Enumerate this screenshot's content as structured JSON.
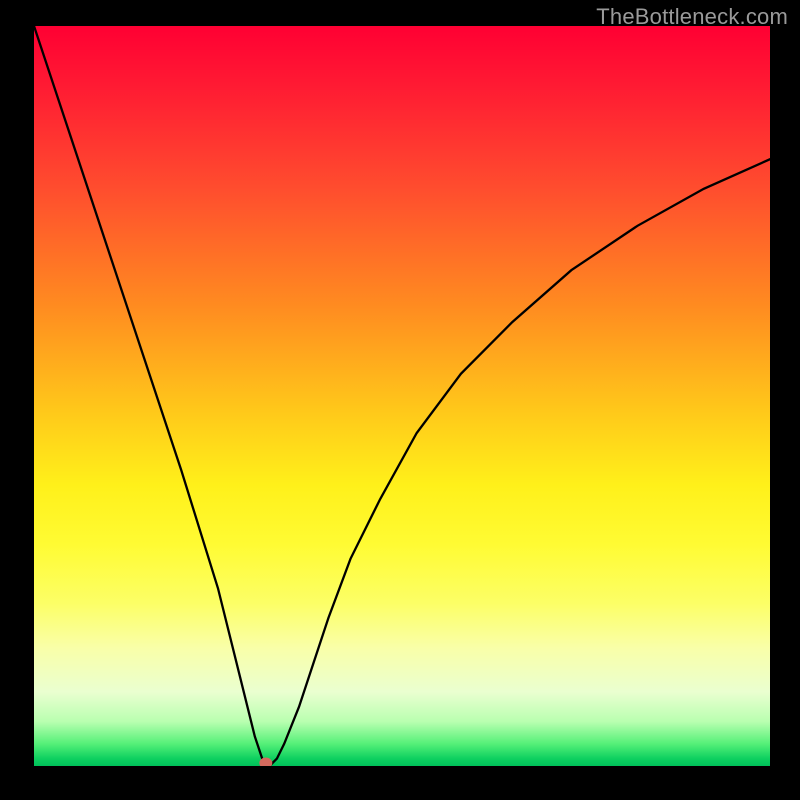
{
  "watermark": "TheBottleneck.com",
  "chart_data": {
    "type": "line",
    "title": "",
    "xlabel": "",
    "ylabel": "",
    "xlim": [
      0,
      100
    ],
    "ylim": [
      0,
      100
    ],
    "grid": false,
    "legend": false,
    "background_gradient": {
      "top": "#ff0033",
      "middle": "#fff01a",
      "bottom": "#00c05a"
    },
    "series": [
      {
        "name": "bottleneck-curve",
        "x": [
          0,
          5,
          10,
          15,
          20,
          25,
          28,
          30,
          31,
          32,
          33,
          34,
          36,
          38,
          40,
          43,
          47,
          52,
          58,
          65,
          73,
          82,
          91,
          100
        ],
        "values": [
          100,
          85,
          70,
          55,
          40,
          24,
          12,
          4,
          1,
          0,
          1,
          3,
          8,
          14,
          20,
          28,
          36,
          45,
          53,
          60,
          67,
          73,
          78,
          82
        ]
      }
    ],
    "marker": {
      "x": 31.5,
      "y": 0,
      "color": "#d46a5e"
    }
  }
}
